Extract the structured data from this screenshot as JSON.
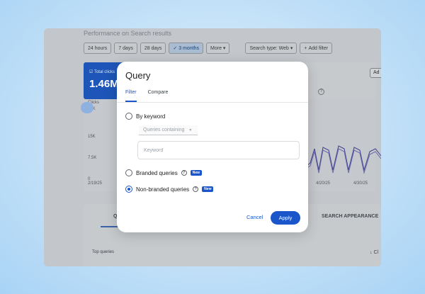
{
  "background": {
    "title": "Performance on Search results",
    "date_chips": [
      "24 hours",
      "7 days",
      "28 days",
      "3 months"
    ],
    "more_label": "More",
    "search_type_label": "Search type: Web",
    "add_filter_label": "Add filter",
    "total_clicks_label": "Total clicks",
    "total_clicks_value": "1.46M",
    "add_button_label": "Ad",
    "chart": {
      "ylabel": "Clicks",
      "y_ticks": [
        "23K",
        "15K",
        "7.5K",
        "0"
      ],
      "x_ticks": [
        "2/19/25",
        "4/20/25",
        "4/30/25"
      ]
    },
    "lower_tabs": [
      "Q",
      "SEARCH APPEARANCE"
    ],
    "top_queries_label": "Top queries",
    "sort_label": "Cl"
  },
  "modal": {
    "title": "Query",
    "tabs": [
      {
        "label": "Filter",
        "active": true
      },
      {
        "label": "Compare",
        "active": false
      }
    ],
    "options": {
      "by_keyword": "By keyword",
      "select_value": "Queries containing",
      "keyword_placeholder": "Keyword",
      "branded": "Branded queries",
      "non_branded": "Non-branded queries",
      "new_badge": "New"
    },
    "cancel_label": "Cancel",
    "apply_label": "Apply"
  },
  "colors": {
    "accent": "#1a56c9",
    "overlay": "#c3c6ca",
    "page_bg": "#c9e4f8"
  }
}
